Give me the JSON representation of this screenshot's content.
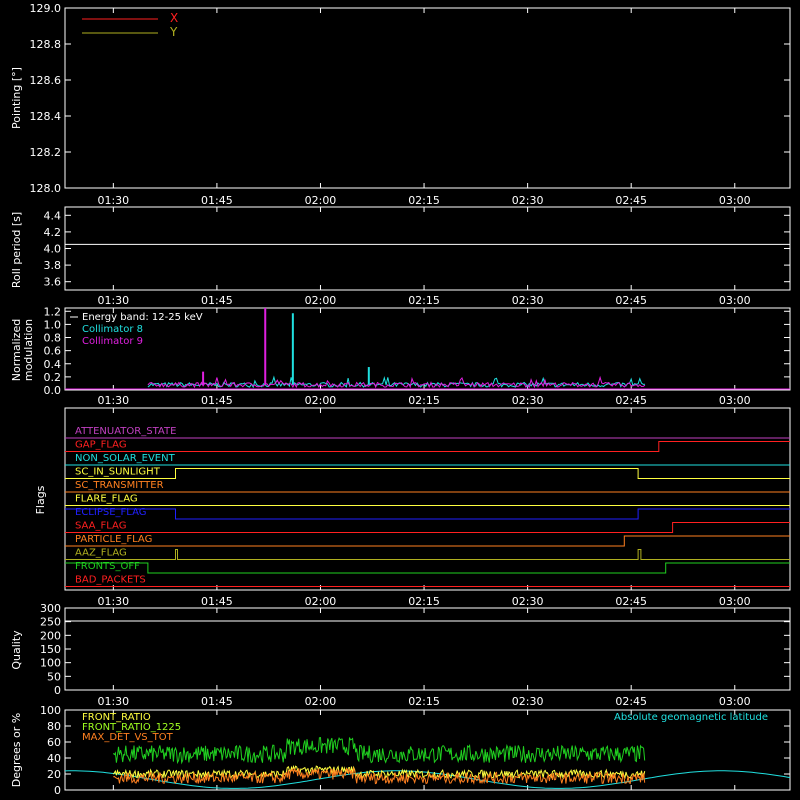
{
  "time_axis": {
    "tick_labels": [
      "01:30",
      "01:45",
      "02:00",
      "02:15",
      "02:30",
      "02:45",
      "03:00"
    ],
    "start_min": 83,
    "end_min": 188,
    "tick_min": [
      90,
      105,
      120,
      135,
      150,
      165,
      180
    ]
  },
  "colors": {
    "axis": "#ffffff",
    "red": "#ff2020",
    "olive": "#b0b020",
    "cyan": "#20e0e0",
    "magenta": "#e020e0",
    "green": "#20d020",
    "yellow": "#ffff40",
    "orange": "#ff8020",
    "blue": "#2020ff",
    "purple": "#c040c0",
    "lime": "#a0ff20"
  },
  "chart_data": [
    {
      "type": "line",
      "ylabel": "Pointing [°]",
      "ylim": [
        128.0,
        129.0
      ],
      "y_ticks": [
        "128.0",
        "128.2",
        "128.4",
        "128.6",
        "128.8",
        "129.0"
      ],
      "legend": [
        "X",
        "Y"
      ],
      "series": [
        {
          "name": "X",
          "values": []
        },
        {
          "name": "Y",
          "values": []
        }
      ]
    },
    {
      "type": "line",
      "ylabel": "Roll period [s]",
      "ylim": [
        3.5,
        4.5
      ],
      "y_ticks": [
        "3.6",
        "3.8",
        "4.0",
        "4.2",
        "4.4"
      ],
      "series": [
        {
          "x": [
            83,
            188
          ],
          "values": [
            4.05,
            4.05
          ]
        }
      ]
    },
    {
      "type": "line",
      "ylabel": "Normalized modulation",
      "ylim": [
        0.0,
        1.25
      ],
      "y_ticks": [
        "0.0",
        "0.2",
        "0.4",
        "0.6",
        "0.8",
        "1.0",
        "1.2"
      ],
      "legend": [
        "Energy band: 12-25 keV",
        "Collimator 8",
        "Collimator 9"
      ],
      "data_range_min": [
        95,
        167
      ],
      "spikes": [
        {
          "series": "Collimator 9",
          "x": 112,
          "value": 1.25
        },
        {
          "series": "Collimator 8",
          "x": 116,
          "value": 1.17
        },
        {
          "series": "Collimator 8",
          "x": 127,
          "value": 0.35
        },
        {
          "series": "Collimator 9",
          "x": 103,
          "value": 0.28
        }
      ],
      "baseline": 0.08
    },
    {
      "type": "line",
      "ylabel": "Flags",
      "flags": [
        {
          "label": "ATTENUATOR_STATE",
          "color": "#c040c0",
          "transitions": [
            [
              83,
              0
            ]
          ]
        },
        {
          "label": "GAP_FLAG",
          "color": "#ff2020",
          "transitions": [
            [
              83,
              0
            ],
            [
              169,
              1
            ]
          ]
        },
        {
          "label": "NON_SOLAR_EVENT",
          "color": "#20e0e0",
          "transitions": [
            [
              83,
              0
            ]
          ]
        },
        {
          "label": "SC_IN_SUNLIGHT",
          "color": "#ffff40",
          "transitions": [
            [
              83,
              0
            ],
            [
              99,
              1
            ],
            [
              166,
              0
            ]
          ]
        },
        {
          "label": "SC_TRANSMITTER",
          "color": "#ff8020",
          "transitions": [
            [
              83,
              0
            ]
          ]
        },
        {
          "label": "FLARE_FLAG",
          "color": "#ffff40",
          "transitions": [
            [
              83,
              0
            ]
          ]
        },
        {
          "label": "ECLIPSE_FLAG",
          "color": "#2020ff",
          "transitions": [
            [
              83,
              1
            ],
            [
              99,
              0
            ],
            [
              166,
              1
            ]
          ]
        },
        {
          "label": "SAA_FLAG",
          "color": "#ff2020",
          "transitions": [
            [
              83,
              0
            ],
            [
              171,
              1
            ]
          ]
        },
        {
          "label": "PARTICLE_FLAG",
          "color": "#ff8020",
          "transitions": [
            [
              83,
              0
            ],
            [
              164,
              1
            ]
          ]
        },
        {
          "label": "AAZ_FLAG",
          "color": "#b0b020",
          "transitions": [
            [
              83,
              0
            ],
            [
              99,
              1
            ],
            [
              99.3,
              0
            ],
            [
              166,
              1
            ],
            [
              166.4,
              0
            ]
          ]
        },
        {
          "label": "FRONTS_OFF",
          "color": "#20d020",
          "transitions": [
            [
              83,
              1
            ],
            [
              95,
              0
            ],
            [
              170,
              1
            ]
          ]
        },
        {
          "label": "BAD_PACKETS",
          "color": "#ff2020",
          "transitions": [
            [
              83,
              0
            ]
          ]
        }
      ]
    },
    {
      "type": "line",
      "ylabel": "Quality",
      "ylim": [
        0,
        300
      ],
      "y_ticks": [
        "0",
        "50",
        "100",
        "150",
        "200",
        "250",
        "300"
      ],
      "series": [
        {
          "x": [
            83,
            188
          ],
          "values": [
            0,
            0
          ]
        }
      ]
    },
    {
      "type": "line",
      "ylabel": "Degrees or %",
      "ylim": [
        0,
        100
      ],
      "y_ticks": [
        "0",
        "20",
        "40",
        "60",
        "80",
        "100"
      ],
      "legend": [
        "FRONT_RATIO",
        "FRONT_RATIO_1225",
        "MAX_DET_VS_TOT"
      ],
      "right_legend": "Absolute geomagnetic latitude",
      "series": [
        {
          "name": "FRONT_RATIO",
          "color": "#ffff40",
          "range": [
            90,
            167
          ],
          "level": 20
        },
        {
          "name": "FRONT_RATIO_1225",
          "color": "#20d020",
          "range": [
            90,
            167
          ],
          "level": 45
        },
        {
          "name": "MAX_DET_VS_TOT",
          "color": "#ff8020",
          "range": [
            90,
            167
          ],
          "level": 15
        },
        {
          "name": "Absolute geomagnetic latitude",
          "color": "#20e0e0",
          "range": [
            83,
            188
          ]
        }
      ]
    }
  ]
}
